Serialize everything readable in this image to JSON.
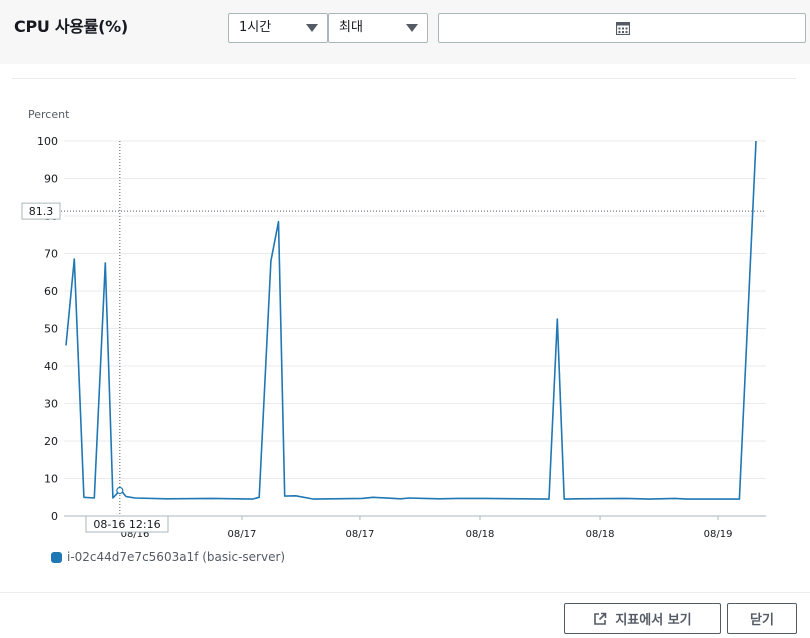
{
  "header": {
    "title": "CPU 사용률(%)",
    "period_select": {
      "value": "1시간"
    },
    "stat_select": {
      "value": "최대"
    },
    "date_range": {
      "value": ""
    }
  },
  "chart_data": {
    "type": "line",
    "ylabel": "Percent",
    "ylim": [
      0,
      100
    ],
    "yticks": [
      0,
      10,
      20,
      30,
      40,
      50,
      60,
      70,
      80,
      90,
      100
    ],
    "xtick_labels": [
      "08/16",
      "08/17",
      "08/17",
      "08/18",
      "08/18",
      "08/19"
    ],
    "xtick_positions": [
      0.1,
      0.255,
      0.426,
      0.6,
      0.774,
      0.945
    ],
    "grid": true,
    "crosshair": {
      "x_label": "08-16 12:16",
      "y_value": 81.3,
      "x": 0.078
    },
    "series": [
      {
        "name": "i-02c44d7e7c5603a1f (basic-server)",
        "color": "#1f77b4",
        "x": [
          0,
          0.012,
          0.026,
          0.041,
          0.057,
          0.068,
          0.079,
          0.087,
          0.1,
          0.146,
          0.212,
          0.27,
          0.28,
          0.297,
          0.308,
          0.317,
          0.333,
          0.359,
          0.429,
          0.445,
          0.485,
          0.497,
          0.52,
          0.541,
          0.568,
          0.608,
          0.7,
          0.712,
          0.722,
          0.743,
          0.809,
          0.846,
          0.882,
          0.9,
          0.97,
          0.976,
          1
        ],
        "values": [
          45.5,
          68.5,
          5,
          4.8,
          67.5,
          4.8,
          7,
          5.2,
          4.8,
          4.6,
          4.7,
          4.5,
          5,
          68,
          78.5,
          5.3,
          5.4,
          4.5,
          4.7,
          5,
          4.6,
          4.8,
          4.7,
          4.6,
          4.7,
          4.7,
          4.5,
          52.5,
          4.5,
          4.6,
          4.7,
          4.5,
          4.7,
          4.5,
          4.5,
          4.5,
          100
        ]
      }
    ]
  },
  "legend": {
    "label": "i-02c44d7e7c5603a1f (basic-server)"
  },
  "footer": {
    "view_metrics_label": "지표에서 보기",
    "close_label": "닫기"
  },
  "icons": {
    "calendar": "calendar-icon",
    "external": "external-link-icon"
  }
}
